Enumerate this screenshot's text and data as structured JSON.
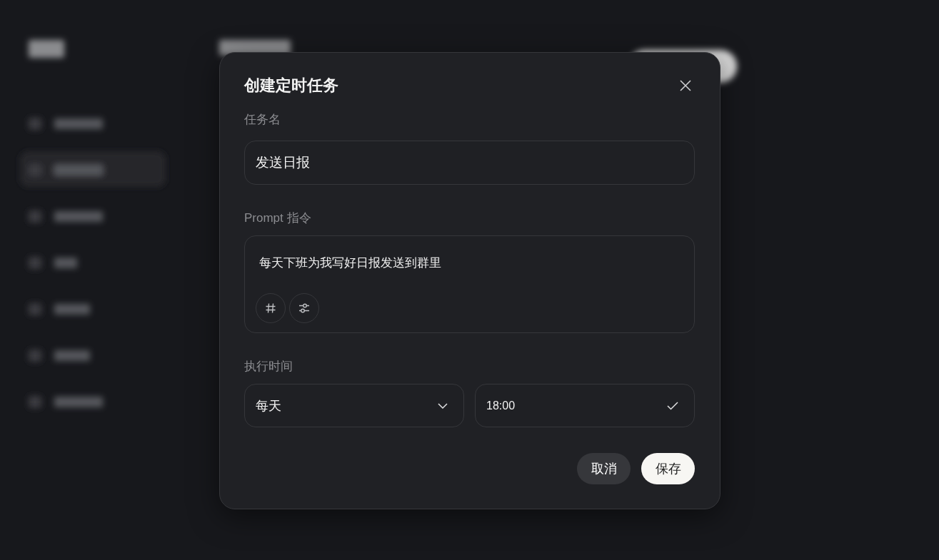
{
  "dialog": {
    "title": "创建定时任务",
    "name_field": {
      "label": "任务名",
      "value": "发送日报"
    },
    "prompt_field": {
      "label": "Prompt 指令",
      "value": "每天下班为我写好日报发送到群里"
    },
    "schedule": {
      "label": "执行时间",
      "frequency": "每天",
      "time": "18:00"
    },
    "buttons": [
      {
        "label": "取消",
        "kind": "secondary"
      },
      {
        "label": "保存",
        "kind": "primary"
      }
    ]
  }
}
